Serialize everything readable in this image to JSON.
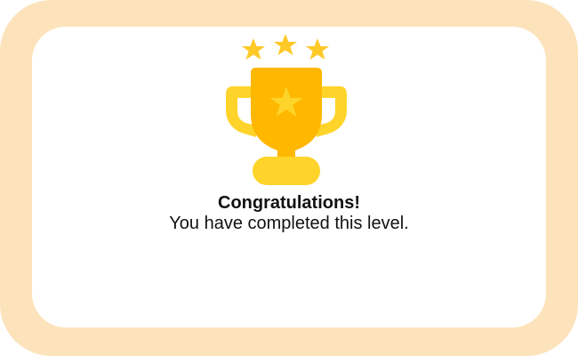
{
  "dialog": {
    "title": "Congratulations!",
    "message": "You have completed this level."
  },
  "icons": {
    "trophy": "trophy-icon",
    "stars": [
      "star-icon",
      "star-icon",
      "star-icon"
    ],
    "emblem": "star-icon"
  },
  "colors": {
    "frame": "#fde3bb",
    "card": "#ffffff",
    "trophy_cup": "#ffb700",
    "trophy_handles": "#ffd42a",
    "star": "#ffd42a",
    "text": "#111111"
  }
}
